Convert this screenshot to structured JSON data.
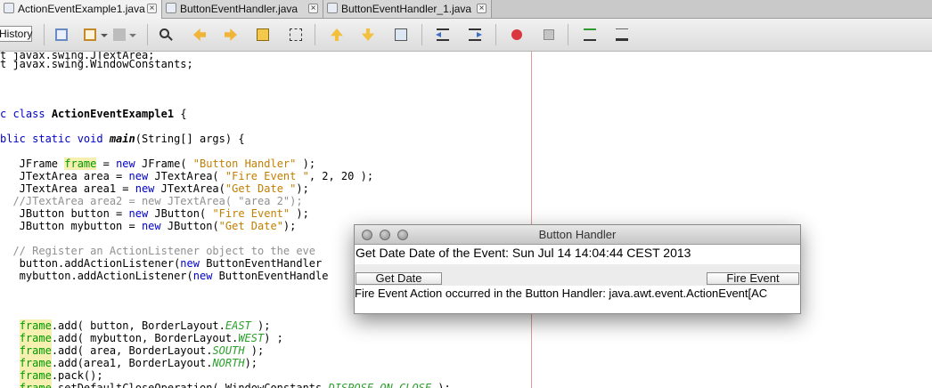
{
  "tabs": [
    {
      "label": "ActionEventExample1.java",
      "active": true
    },
    {
      "label": "ButtonEventHandler.java",
      "active": false
    },
    {
      "label": "ButtonEventHandler_1.java",
      "active": false
    }
  ],
  "toolbar": {
    "history_label": "History",
    "buttons": [
      "last-edit-icon",
      "back-icon",
      "forward-icon",
      "find-icon",
      "find-previous-icon",
      "find-next-icon",
      "toggle-highlight-icon",
      "toggle-rectangular-selection-icon",
      "previous-bookmark-icon",
      "next-bookmark-icon",
      "toggle-bookmark-icon",
      "shift-left-icon",
      "shift-right-icon",
      "start-macro-icon",
      "stop-macro-icon",
      "comment-icon",
      "uncomment-icon"
    ]
  },
  "code_lines": [
    "t javax.swing.JTextArea;",
    "t javax.swing.WindowConstants;",
    "",
    "",
    "c class ActionEventExample1 {",
    "",
    "blic static void main(String[] args) {",
    "",
    "  JFrame frame = new JFrame( \"Button Handler\" );",
    "  JTextArea area = new JTextArea( \"Fire Event \", 2, 20 );",
    "  JTextArea area1 = new JTextArea(\"Get Date \");",
    "  //JTextArea area2 = new JTextArea( \"area 2\");",
    "  JButton button = new JButton( \"Fire Event\" );",
    "  JButton mybutton = new JButton(\"Get Date\");",
    "",
    "  // Register an ActionListener object to the eve",
    "  button.addActionListener(new ButtonEventHandler",
    "  mybutton.addActionListener(new ButtonEventHandle",
    "",
    "",
    "",
    "  frame.add( button, BorderLayout.EAST );",
    "  frame.add( mybutton, BorderLayout.WEST) ;",
    "  frame.add( area, BorderLayout.SOUTH );",
    "  frame.add(area1, BorderLayout.NORTH);",
    "  frame.pack();",
    "  frame.setDefaultCloseOperation( WindowConstants.DISPOSE_ON_CLOSE );"
  ],
  "window": {
    "title": "Button Handler",
    "north_text": "Get Date Date of the Event: Sun Jul 14 14:04:44 CEST 2013",
    "get_date_label": "Get Date",
    "fire_event_label": "Fire Event",
    "south_text": "Fire Event Action occurred in the Button Handler: java.awt.event.ActionEvent[AC"
  },
  "colors": {
    "keyword": "#0000c8",
    "string": "#c27e00",
    "comment": "#909090",
    "field": "#009a00",
    "margin_line": "#e39a9a"
  }
}
